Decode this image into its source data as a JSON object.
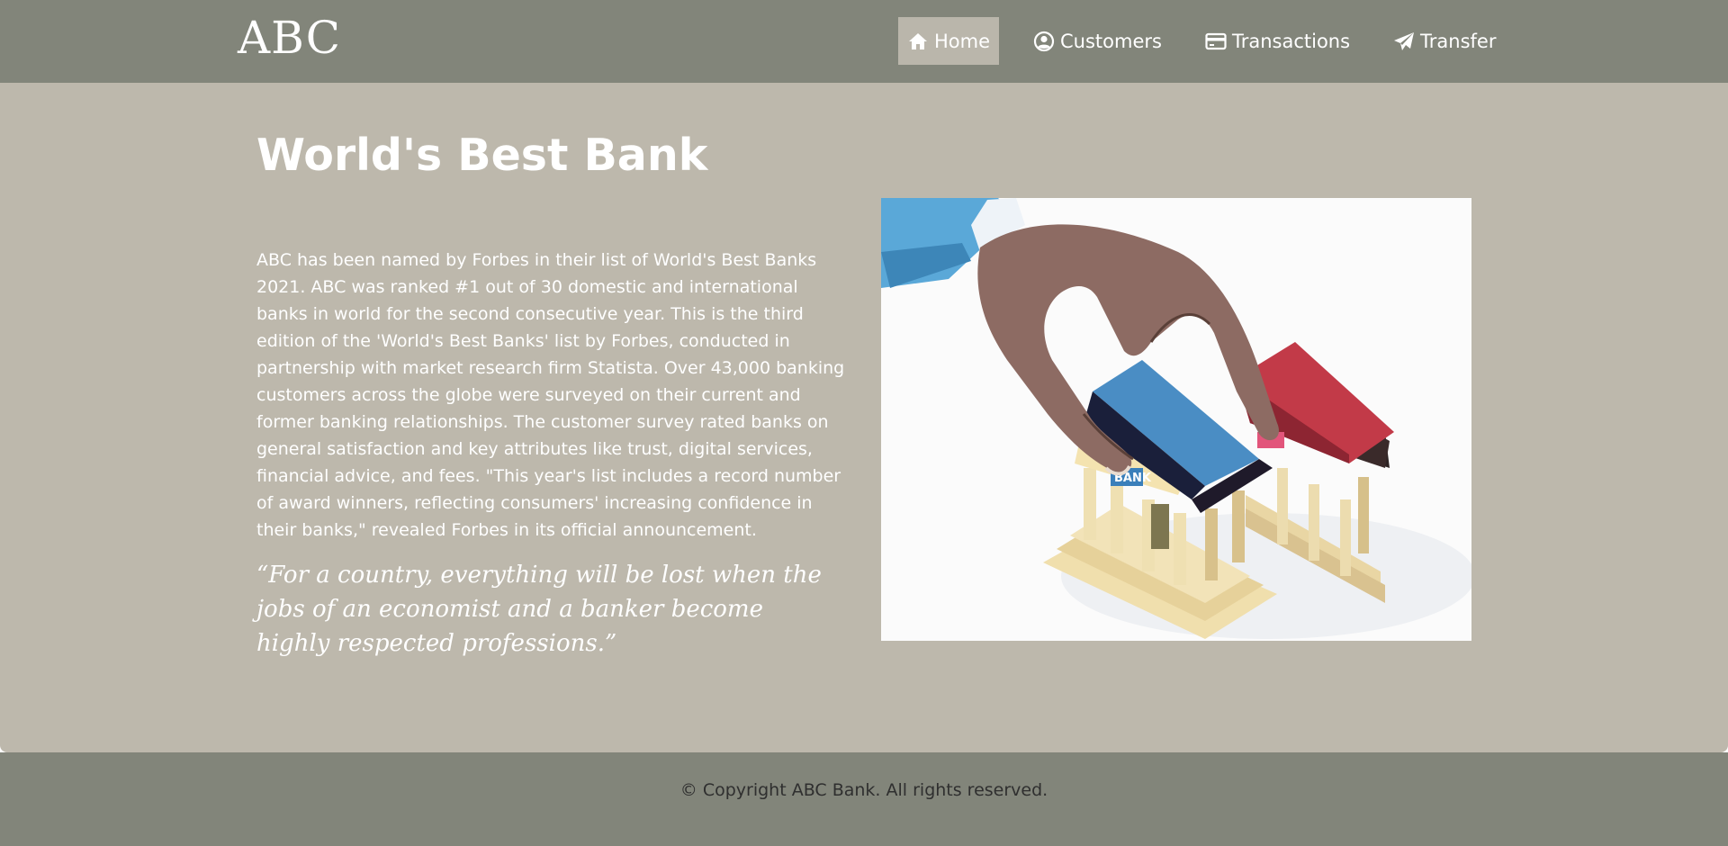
{
  "brand": {
    "logo_text": "ABC"
  },
  "nav": {
    "items": [
      {
        "label": "Home",
        "icon": "home-icon",
        "active": true
      },
      {
        "label": "Customers",
        "icon": "user-circle-icon",
        "active": false
      },
      {
        "label": "Transactions",
        "icon": "credit-card-icon",
        "active": false
      },
      {
        "label": "Transfer",
        "icon": "paper-plane-icon",
        "active": false
      }
    ]
  },
  "main": {
    "title": "World's Best Bank",
    "article": "ABC has been named by Forbes in their list of World's Best Banks 2021. ABC was ranked #1 out of 30 domestic and international banks in world for the second consecutive year. This is the third edition of the 'World's Best Banks' list by Forbes, conducted in partnership with market research firm Statista. Over 43,000 banking customers across the globe were surveyed on their current and former banking relationships. The customer survey rated banks on general satisfaction and key attributes like trust, digital services, financial advice, and fees. \"This year's list includes a record number of award winners, reflecting consumers' increasing confidence in their banks,\" revealed Forbes in its official announcement.",
    "quote": "“For a country, everything will be lost when the jobs of an economist and a banker become highly respected professions.”",
    "hero_image": {
      "subject": "hand placing a bank building next to another bank building",
      "sign_text": "BANK"
    }
  },
  "footer": {
    "copyright": "© Copyright ABC Bank. All rights reserved."
  },
  "colors": {
    "nav_bg": "#82857a",
    "main_bg": "#bdb8ac",
    "active_nav_bg": "#bab6ab",
    "text_light": "#ffffff",
    "footer_text": "#2f2f2f"
  }
}
